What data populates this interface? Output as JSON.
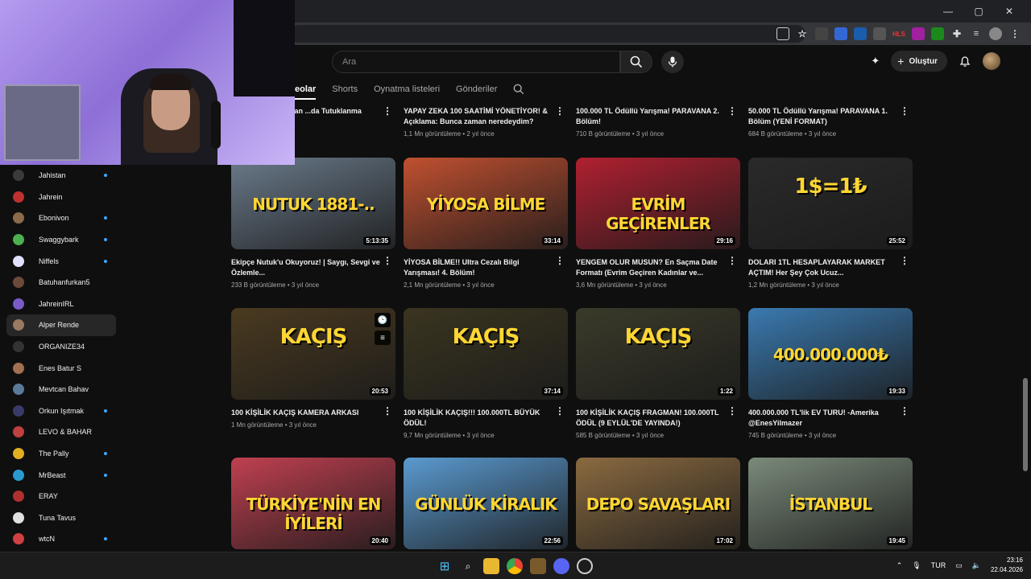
{
  "search": {
    "placeholder": "Ara"
  },
  "header": {
    "create_label": "Oluştur"
  },
  "tabs": [
    {
      "label": "eolar"
    },
    {
      "label": "Shorts"
    },
    {
      "label": "Oynatma listeleri"
    },
    {
      "label": "Gönderiler"
    }
  ],
  "sidebar": {
    "items": [
      {
        "label": "Jahistan",
        "dot": true,
        "color": "#3a3a3a"
      },
      {
        "label": "Jahrein",
        "dot": false,
        "color": "#c03030"
      },
      {
        "label": "Ebonivon",
        "dot": true,
        "color": "#8a6a4a"
      },
      {
        "label": "Swaggybark",
        "dot": true,
        "color": "#4caf50"
      },
      {
        "label": "Niffels",
        "dot": true,
        "color": "#e0e0ff"
      },
      {
        "label": "Batuhanfurkan5",
        "dot": false,
        "color": "#6b4a3a"
      },
      {
        "label": "JahreinIRL",
        "dot": false,
        "color": "#7a5cc8"
      },
      {
        "label": "Alper Rende",
        "dot": false,
        "color": "#9a7a60",
        "active": true
      },
      {
        "label": "ORGANIZE34",
        "dot": false,
        "color": "#333"
      },
      {
        "label": "Enes Batur S",
        "dot": false,
        "color": "#a07050"
      },
      {
        "label": "Mevtcan Bahav",
        "dot": false,
        "color": "#5a7a9a"
      },
      {
        "label": "Orkun Işıtmak",
        "dot": true,
        "color": "#3a3a6a"
      },
      {
        "label": "LEVO & BAHAR",
        "dot": false,
        "color": "#c04040"
      },
      {
        "label": "The Pally",
        "dot": true,
        "color": "#e0b020"
      },
      {
        "label": "MrBeast",
        "dot": true,
        "color": "#2a9ad0"
      },
      {
        "label": "ERAY",
        "dot": false,
        "color": "#b03030"
      },
      {
        "label": "Tuna Tavus",
        "dot": false,
        "color": "#e0e0e0"
      },
      {
        "label": "wtcN",
        "dot": true,
        "color": "#d04040"
      }
    ]
  },
  "videos_top": [
    {
      "title": "...eyince Kırbaçlayan ...da Tutuklanma Macera...",
      "info": "...2 yıl önce"
    },
    {
      "title": "YAPAY ZEKA 100 SAATİMİ YÖNETİYOR! & Açıklama: Bunca zaman neredeydim?",
      "info": "1,1 Mn görüntüleme • 2 yıl önce"
    },
    {
      "title": "100.000 TL Ödüllü Yarışma! PARAVANA 2. Bölüm!",
      "info": "710 B görüntüleme • 3 yıl önce"
    },
    {
      "title": "50.000 TL Ödüllü Yarışma! PARAVANA 1. Bölüm (YENİ FORMAT)",
      "info": "684 B görüntüleme • 3 yıl önce"
    }
  ],
  "videos_row2": [
    {
      "title": "Ekipçe Nutuk'u Okuyoruz! | Saygı, Sevgi ve Özlemle...",
      "info": "233 B görüntüleme • 3 yıl önce",
      "duration": "5:13:35",
      "overlay": "NUTUK 1881-..",
      "color": "#6a7a8a"
    },
    {
      "title": "YİYOSA BİLME!! Ultra Cezalı Bilgi Yarışması! 4. Bölüm!",
      "info": "2,1 Mn görüntüleme • 3 yıl önce",
      "duration": "33:14",
      "overlay": "YİYOSA BİLME",
      "color": "#c05030"
    },
    {
      "title": "YENGEM OLUR MUSUN? En Saçma Date Formatı (Evrim Geçiren Kadınlar ve...",
      "info": "3,6 Mn görüntüleme • 3 yıl önce",
      "duration": "29:16",
      "overlay": "EVRİM GEÇİRENLER",
      "color": "#b02030"
    },
    {
      "title": "DOLARI 1TL HESAPLAYARAK MARKET AÇTIM! Her Şey Çok Ucuz...",
      "info": "1,2 Mn görüntüleme • 3 yıl önce",
      "duration": "25:52",
      "overlay": "1$=1₺",
      "color": "#2a2a2a"
    }
  ],
  "videos_row3": [
    {
      "title": "100 KİŞİLİK KAÇIŞ KAMERA ARKASI",
      "info": "1 Mn görüntüleme • 3 yıl önce",
      "duration": "20:53",
      "overlay": "KAÇIŞ",
      "color": "#4a3a20"
    },
    {
      "title": "100 KİŞİLİK KAÇIŞ!!! 100.000TL BÜYÜK ÖDÜL!",
      "info": "9,7 Mn görüntüleme • 3 yıl önce",
      "duration": "37:14",
      "overlay": "KAÇIŞ",
      "color": "#3a3520"
    },
    {
      "title": "100 KİŞİLİK KAÇIŞ FRAGMAN! 100.000TL ÖDÜL (9 EYLÜL'DE YAYINDA!)",
      "info": "585 B görüntüleme • 3 yıl önce",
      "duration": "1:22",
      "overlay": "KAÇIŞ",
      "color": "#3a3a2a"
    },
    {
      "title": "400.000.000 TL'lik EV TURU! -Amerika @EnesYilmazer",
      "info": "745 B görüntüleme • 3 yıl önce",
      "duration": "19:33",
      "overlay": "400.000.000₺",
      "color": "#3a7ab0"
    }
  ],
  "videos_row4": [
    {
      "duration": "20:40",
      "overlay": "TÜRKİYE'NİN EN İYİLERİ",
      "color": "#c04050"
    },
    {
      "duration": "22:56",
      "overlay": "GÜNLÜK KİRALIK",
      "color": "#5a9ad0"
    },
    {
      "duration": "17:02",
      "overlay": "DEPO SAVAŞLARI",
      "color": "#8a6a40"
    },
    {
      "duration": "19:45",
      "overlay": "İSTANBUL",
      "color": "#7a8a7a"
    }
  ],
  "taskbar": {
    "lang": "TUR",
    "time": "23:16",
    "date": "22.04.2026"
  }
}
